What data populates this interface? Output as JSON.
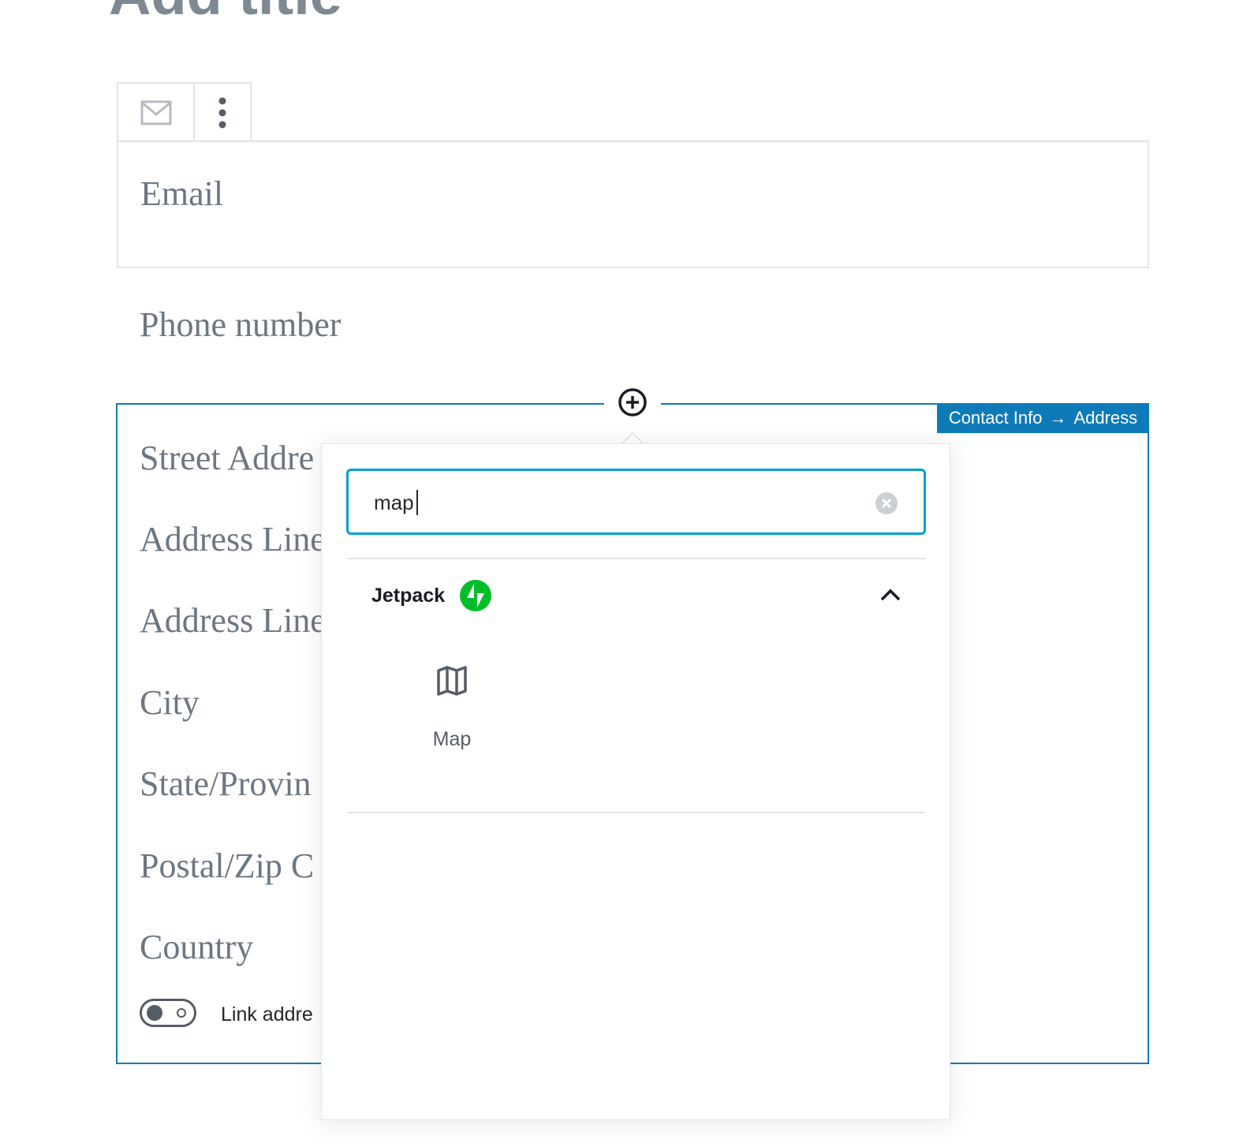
{
  "page": {
    "title": "Add title"
  },
  "email_block": {
    "toolbar": {
      "block_icon": "mail-icon",
      "more_icon": "more-vertical-icon"
    },
    "placeholder": "Email"
  },
  "phone_block": {
    "placeholder": "Phone number"
  },
  "address_block": {
    "breadcrumb": {
      "parent": "Contact Info",
      "arrow": "→",
      "current": "Address"
    },
    "fields": [
      "Street Addre",
      "Address Line",
      "Address Line",
      "City",
      "State/Provin",
      "Postal/Zip C",
      "Country"
    ],
    "toggle_label": "Link addre"
  },
  "inserter": {
    "search": {
      "value": "map",
      "clear_icon": "clear-circle-icon"
    },
    "panel": {
      "title": "Jetpack",
      "icon": "jetpack-bolt-icon",
      "collapse_icon": "chevron-up-icon"
    },
    "results": [
      {
        "label": "Map",
        "icon": "map-icon"
      }
    ]
  },
  "colors": {
    "accent": "#0e7bb8",
    "focus": "#00a0d2",
    "jetpack": "#00be28",
    "text_muted": "#6c7781"
  }
}
